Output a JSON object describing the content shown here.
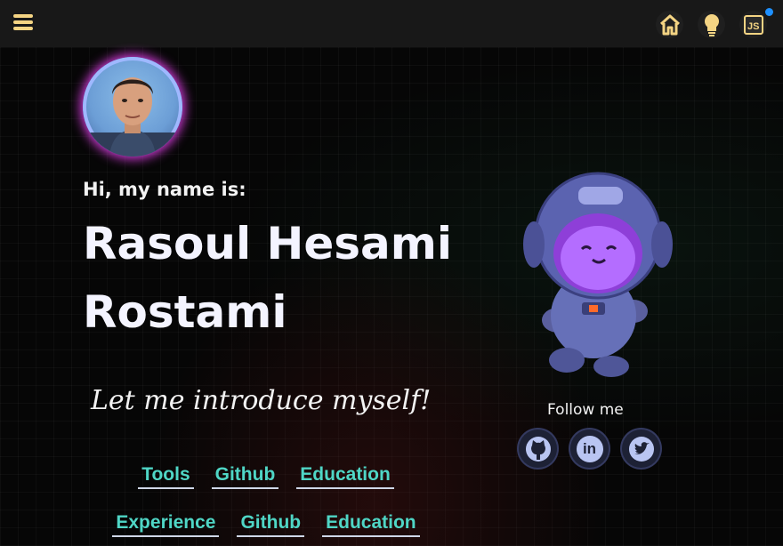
{
  "header": {
    "icons": [
      "menu-icon",
      "home-icon",
      "lightbulb-icon",
      "js-icon"
    ],
    "js_label": "JS",
    "accent": "#f4d483",
    "notification_color": "#1e90ff"
  },
  "hero": {
    "greeting": "Hi, my name is:",
    "name_line1": "Rasoul Hesami",
    "name_line2": "Rostami",
    "intro": "Let me introduce myself!"
  },
  "links": {
    "row1": [
      "Tools",
      "Github",
      "Education"
    ],
    "row2": [
      "Experience",
      "Github",
      "Education"
    ],
    "color": "#4fd6c6"
  },
  "social": {
    "title": "Follow me",
    "items": [
      "github-icon",
      "linkedin-icon",
      "twitter-icon"
    ],
    "linkedin_text": "in"
  }
}
